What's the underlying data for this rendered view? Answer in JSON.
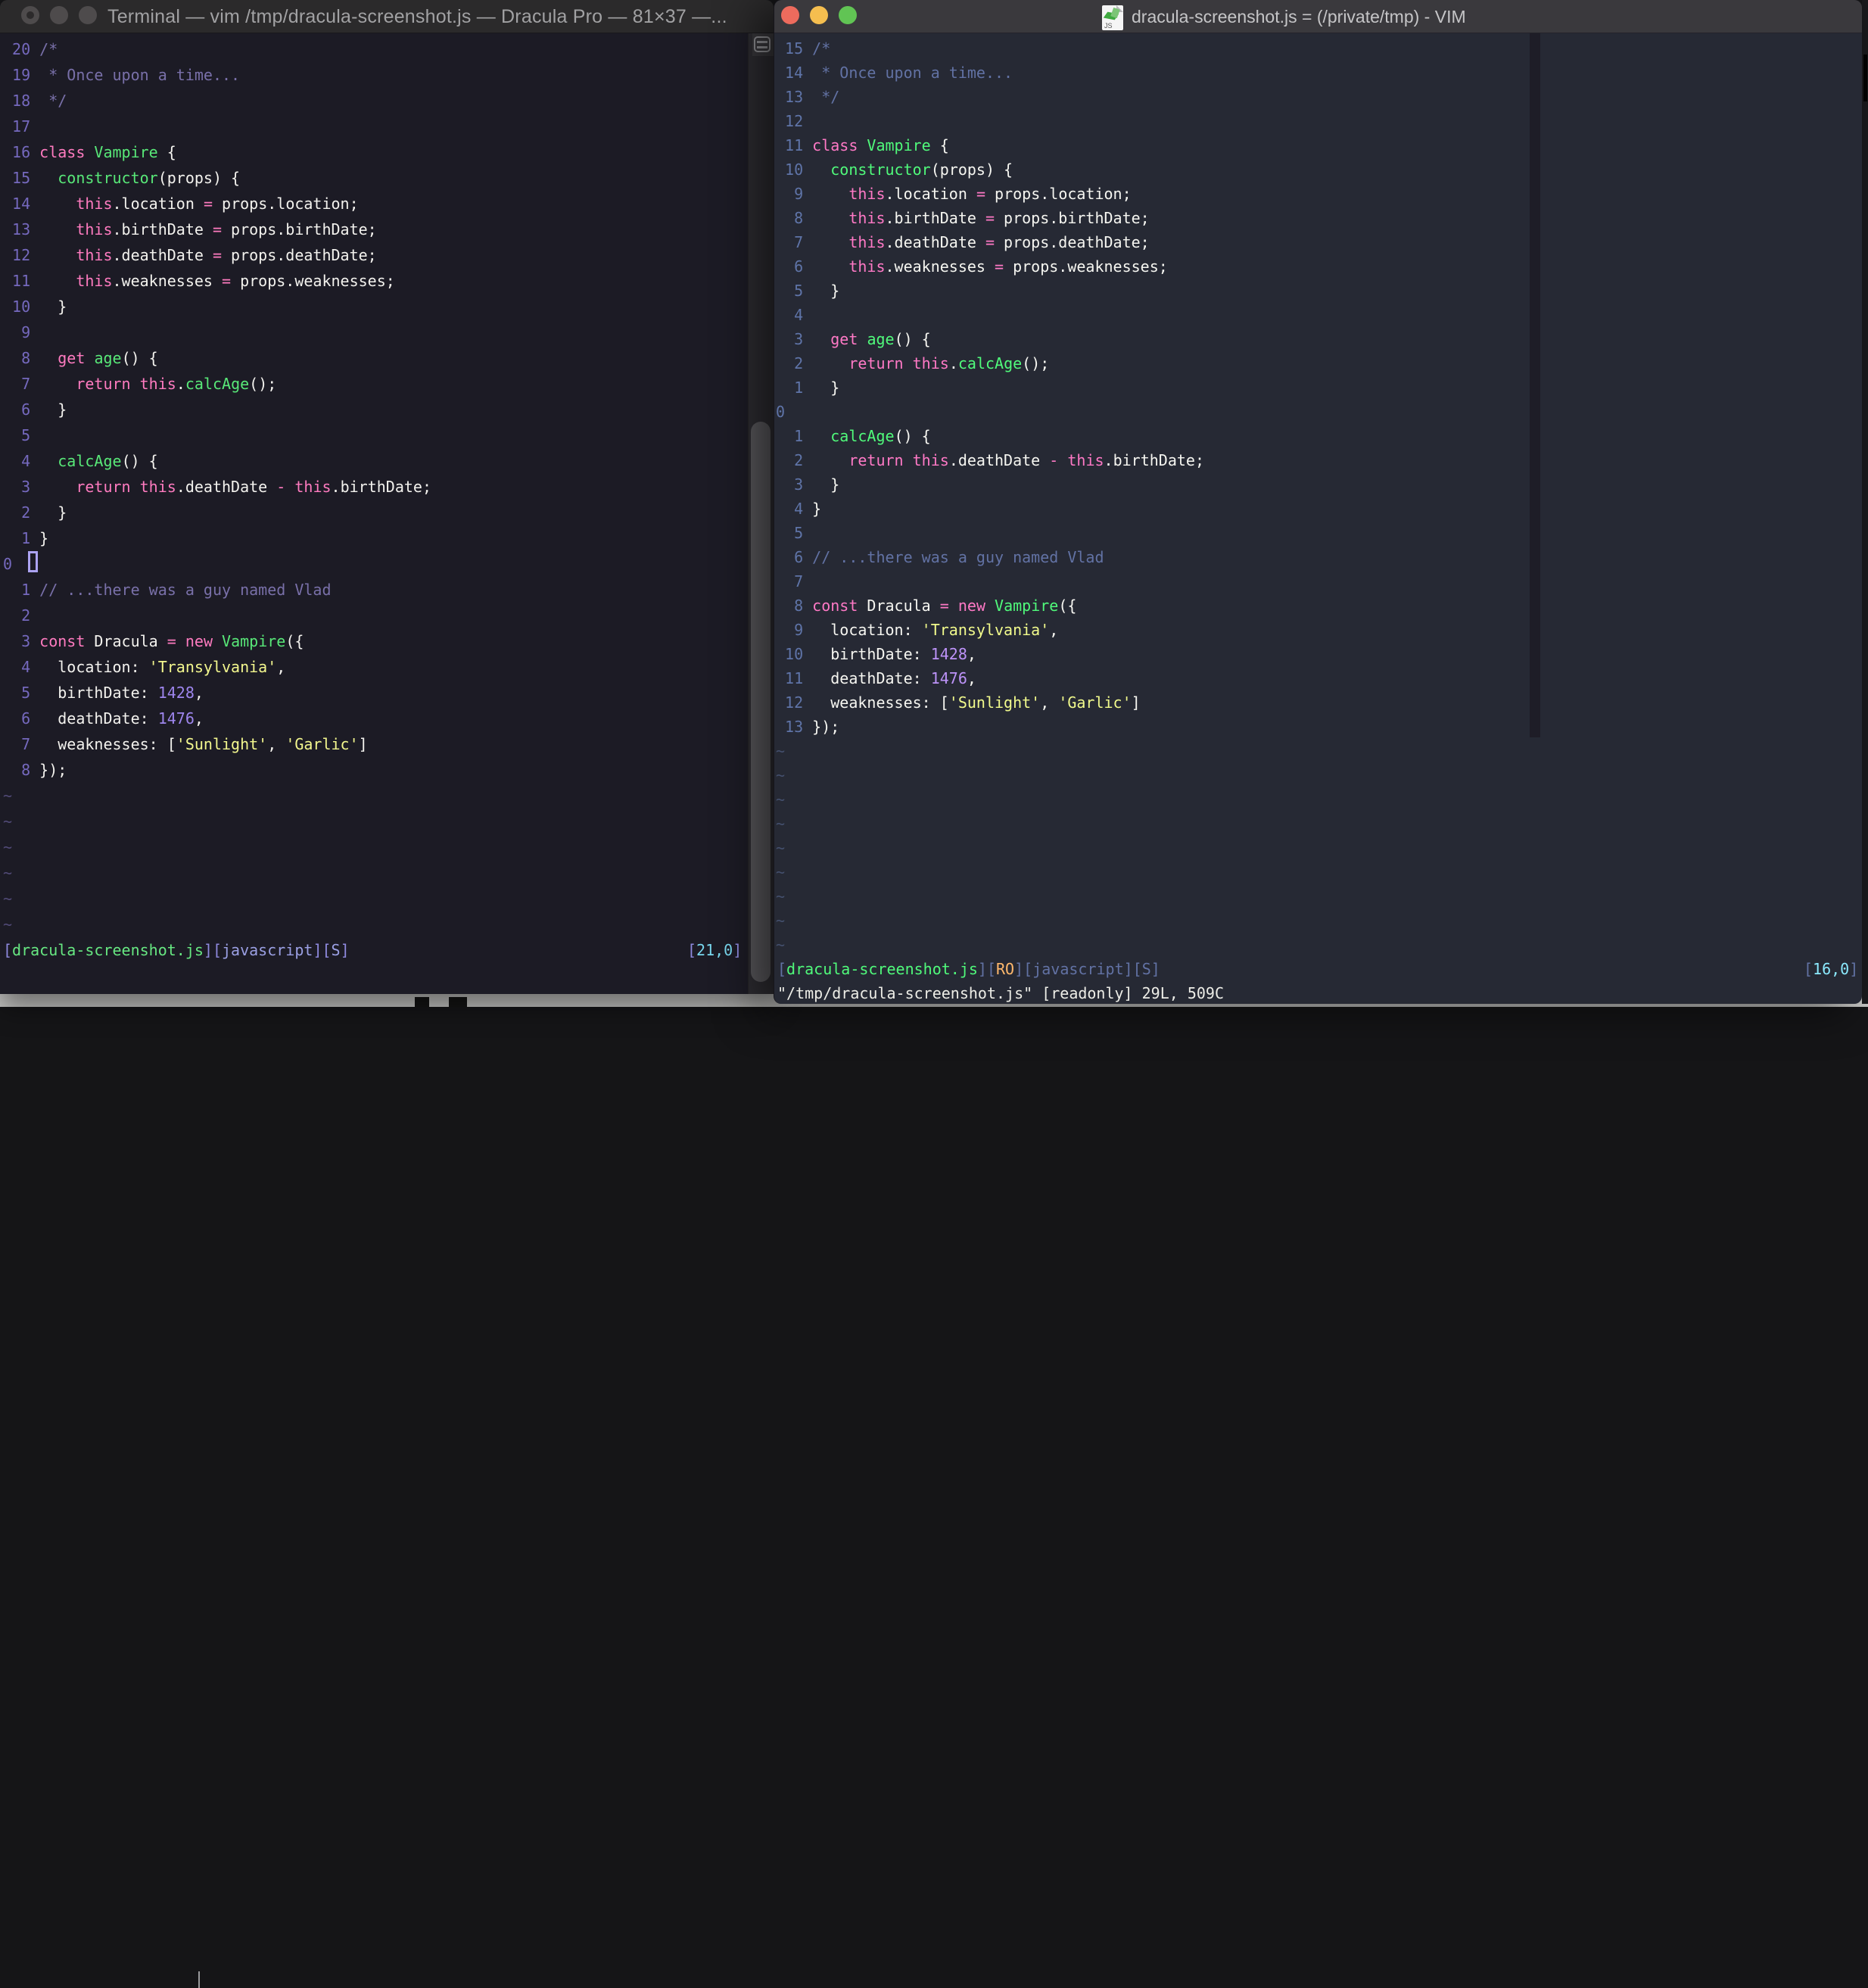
{
  "desktop": {
    "strip_color": "#C7C7C5"
  },
  "shared_code": [
    [
      [
        "c",
        "/*"
      ]
    ],
    [
      [
        "c",
        " * Once upon a time..."
      ]
    ],
    [
      [
        "c",
        " */"
      ]
    ],
    [],
    [
      [
        "k",
        "class "
      ],
      [
        "f",
        "Vampire"
      ],
      [
        "g",
        " {"
      ]
    ],
    [
      [
        "g",
        "  "
      ],
      [
        "f",
        "constructor"
      ],
      [
        "g",
        "(props) {"
      ]
    ],
    [
      [
        "g",
        "    "
      ],
      [
        "k",
        "this"
      ],
      [
        "g",
        ".location "
      ],
      [
        "k",
        "="
      ],
      [
        "g",
        " props.location;"
      ]
    ],
    [
      [
        "g",
        "    "
      ],
      [
        "k",
        "this"
      ],
      [
        "g",
        ".birthDate "
      ],
      [
        "k",
        "="
      ],
      [
        "g",
        " props.birthDate;"
      ]
    ],
    [
      [
        "g",
        "    "
      ],
      [
        "k",
        "this"
      ],
      [
        "g",
        ".deathDate "
      ],
      [
        "k",
        "="
      ],
      [
        "g",
        " props.deathDate;"
      ]
    ],
    [
      [
        "g",
        "    "
      ],
      [
        "k",
        "this"
      ],
      [
        "g",
        ".weaknesses "
      ],
      [
        "k",
        "="
      ],
      [
        "g",
        " props.weaknesses;"
      ]
    ],
    [
      [
        "g",
        "  }"
      ]
    ],
    [],
    [
      [
        "g",
        "  "
      ],
      [
        "k",
        "get "
      ],
      [
        "f",
        "age"
      ],
      [
        "g",
        "() {"
      ]
    ],
    [
      [
        "g",
        "    "
      ],
      [
        "k",
        "return "
      ],
      [
        "k",
        "this"
      ],
      [
        "g",
        "."
      ],
      [
        "f",
        "calcAge"
      ],
      [
        "g",
        "();"
      ]
    ],
    [
      [
        "g",
        "  }"
      ]
    ],
    [],
    [
      [
        "g",
        "  "
      ],
      [
        "f",
        "calcAge"
      ],
      [
        "g",
        "() {"
      ]
    ],
    [
      [
        "g",
        "    "
      ],
      [
        "k",
        "return "
      ],
      [
        "k",
        "this"
      ],
      [
        "g",
        ".deathDate "
      ],
      [
        "k",
        "-"
      ],
      [
        "g",
        " "
      ],
      [
        "k",
        "this"
      ],
      [
        "g",
        ".birthDate;"
      ]
    ],
    [
      [
        "g",
        "  }"
      ]
    ],
    [
      [
        "g",
        "}"
      ]
    ],
    [],
    [
      [
        "c",
        "// ...there was a guy named Vlad"
      ]
    ],
    [],
    [
      [
        "k",
        "const"
      ],
      [
        "g",
        " Dracula "
      ],
      [
        "k",
        "="
      ],
      [
        "g",
        " "
      ],
      [
        "k",
        "new "
      ],
      [
        "f",
        "Vampire"
      ],
      [
        "g",
        "({"
      ]
    ],
    [
      [
        "g",
        "  location: "
      ],
      [
        "s",
        "'Transylvania'"
      ],
      [
        "g",
        ","
      ]
    ],
    [
      [
        "g",
        "  birthDate: "
      ],
      [
        "n",
        "1428"
      ],
      [
        "g",
        ","
      ]
    ],
    [
      [
        "g",
        "  deathDate: "
      ],
      [
        "n",
        "1476"
      ],
      [
        "g",
        ","
      ]
    ],
    [
      [
        "g",
        "  weaknesses: ["
      ],
      [
        "s",
        "'Sunlight'"
      ],
      [
        "g",
        ", "
      ],
      [
        "s",
        "'Garlic'"
      ],
      [
        "g",
        "]"
      ]
    ],
    [
      [
        "g",
        "});"
      ]
    ]
  ],
  "left_window": {
    "title": "Terminal — vim /tmp/dracula-screenshot.js — Dracula Pro — 81×37 —...",
    "cursor_line_index": 20,
    "tilde_count": 6,
    "status_segments": [
      [
        "b",
        "["
      ],
      [
        "f",
        "dracula-screenshot.js"
      ],
      [
        "b",
        "]["
      ],
      [
        "s",
        "javascript"
      ],
      [
        "b",
        "]["
      ],
      [
        "s",
        "S"
      ],
      [
        "b",
        "]"
      ]
    ],
    "ruler_segments": [
      [
        "b",
        "["
      ],
      [
        "c",
        "21,0"
      ],
      [
        "b",
        "]"
      ]
    ],
    "palette": {
      "bg": "#1C1B25",
      "titlebar": "#2B2A2B",
      "title_text": "#A1A1A3",
      "number": "#7569BE",
      "comment": "#7970A9",
      "keyword": "#FF7BC0",
      "func": "#58E878",
      "string": "#F3F78E",
      "num": "#9E86EE",
      "fg": "#F3F2EE",
      "tilde": "#514A77",
      "status_bracket": "#8F8ADF",
      "status_file": "#67E882",
      "status_sec": "#9BA0E4",
      "status_pos": "#79D8EF",
      "status_ro": "#FFB86C",
      "cursor": "#ACA3F2"
    }
  },
  "right_window": {
    "title": "dracula-screenshot.js = (/private/tmp) - VIM",
    "cursor_line_index": 15,
    "tilde_count": 9,
    "status_segments": [
      [
        "b",
        "["
      ],
      [
        "f",
        "dracula-screenshot.js"
      ],
      [
        "b",
        "]["
      ],
      [
        "ro",
        "RO"
      ],
      [
        "b",
        "]["
      ],
      [
        "s",
        "javascript"
      ],
      [
        "b",
        "]["
      ],
      [
        "s",
        "S"
      ],
      [
        "b",
        "]"
      ]
    ],
    "ruler_segments": [
      [
        "b",
        "["
      ],
      [
        "c",
        "16,0"
      ],
      [
        "b",
        "]"
      ]
    ],
    "command_text": "\"/tmp/dracula-screenshot.js\" [readonly] 29L, 509C",
    "palette": {
      "bg": "#262934",
      "titlebar": "#3A393D",
      "title_text": "#C5C5C7",
      "number": "#5F74A8",
      "comment": "#6272A4",
      "keyword": "#FF79C6",
      "func": "#50FA7B",
      "string": "#F1FA8C",
      "num": "#BD93F9",
      "fg": "#F6F6F1",
      "tilde": "#44506E",
      "status_bracket": "#6272A4",
      "status_file": "#50FA7B",
      "status_sec": "#6272A4",
      "status_pos": "#8BE9FD",
      "status_ro": "#FFB86C",
      "cursor": "#F8F8F2",
      "command": "#EDEDE7"
    }
  }
}
